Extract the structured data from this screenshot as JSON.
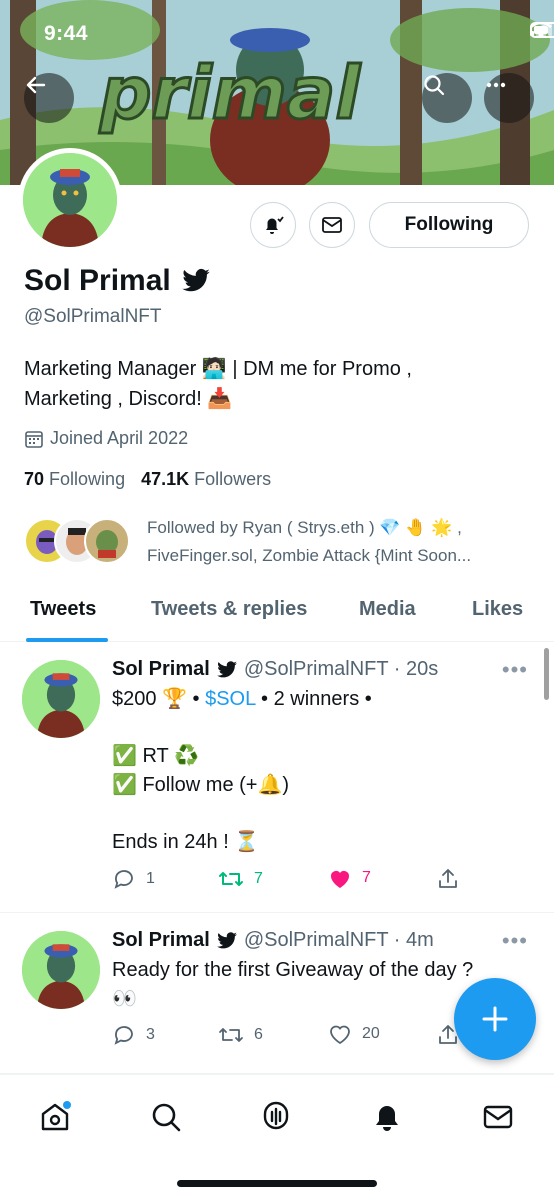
{
  "status_bar": {
    "time": "9:44"
  },
  "banner": {
    "logo_text": "primal"
  },
  "profile": {
    "display_name": "Sol Primal",
    "handle": "@SolPrimalNFT",
    "bio_line1": "Marketing Manager 🧑🏻‍💻 | DM me for Promo ,",
    "bio_line2": "Marketing , Discord! 📥",
    "joined": "Joined April 2022",
    "following_count": "70",
    "following_label": "Following",
    "followers_count": "47.1K",
    "followers_label": "Followers",
    "followed_by_line1": "Followed by Ryan ( Strys.eth ) 💎 🤚 🌟 ,",
    "followed_by_line2": "FiveFinger.sol, Zombie Attack {Mint Soon...",
    "following_button": "Following"
  },
  "tabs": [
    "Tweets",
    "Tweets & replies",
    "Media",
    "Likes"
  ],
  "tweets": [
    {
      "name": "Sol Primal",
      "handle_time": "@SolPrimalNFT · 20s",
      "line1_a": "$200 🏆 • ",
      "line1_link": "$SOL",
      "line1_b": " • 2 winners •",
      "line2": "✅ RT ♻️",
      "line3": "✅ Follow me (+🔔)",
      "line4": "Ends in 24h ! ⏳",
      "replies": "1",
      "retweets": "7",
      "likes": "7"
    },
    {
      "name": "Sol Primal",
      "handle_time": "@SolPrimalNFT · 4m",
      "line1": "Ready for the first Giveaway of the day ?",
      "line2": "👀",
      "replies": "3",
      "retweets": "6",
      "likes": "20"
    }
  ],
  "colors": {
    "accent": "#1d9bf0",
    "like": "#f91880",
    "retweet": "#00ba7c"
  }
}
